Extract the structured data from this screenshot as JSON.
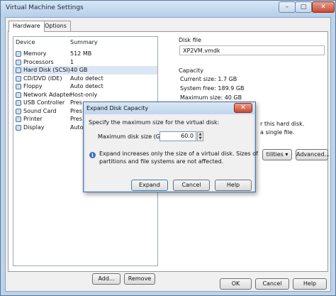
{
  "window": {
    "title": "Virtual Machine Settings",
    "minimize": "–",
    "maximize": "□",
    "close": "✕"
  },
  "tabs": [
    {
      "label": "Hardware"
    },
    {
      "label": "Options"
    }
  ],
  "device_list": {
    "columns": [
      "Device",
      "Summary"
    ],
    "rows": [
      {
        "name": "Memory",
        "summary": "512 MB",
        "icon": "memory-icon"
      },
      {
        "name": "Processors",
        "summary": "1",
        "icon": "processor-icon"
      },
      {
        "name": "Hard Disk (SCSI)",
        "summary": "40 GB",
        "icon": "hard-disk-icon",
        "selected": true
      },
      {
        "name": "CD/DVD (IDE)",
        "summary": "Auto detect",
        "icon": "cd-dvd-icon"
      },
      {
        "name": "Floppy",
        "summary": "Auto detect",
        "icon": "floppy-icon"
      },
      {
        "name": "Network Adapter",
        "summary": "Host-only",
        "icon": "network-icon"
      },
      {
        "name": "USB Controller",
        "summary": "Pres",
        "icon": "usb-icon"
      },
      {
        "name": "Sound Card",
        "summary": "Pres",
        "icon": "sound-card-icon"
      },
      {
        "name": "Printer",
        "summary": "Pres",
        "icon": "printer-icon"
      },
      {
        "name": "Display",
        "summary": "Auto",
        "icon": "display-icon"
      }
    ]
  },
  "buttons": {
    "add": "Add...",
    "remove": "Remove",
    "ok": "OK",
    "cancel": "Cancel",
    "help": "Help"
  },
  "disk_file": {
    "label": "Disk file",
    "value": "XP2VM.vmdk"
  },
  "capacity": {
    "label": "Capacity",
    "current_size": "Current size:  1.7 GB",
    "system_free": "System free:   189.9 GB",
    "maximum_size": "Maximum size:  40 GB"
  },
  "utilities_partial": {
    "line1": "r this hard disk.",
    "line2": "a single file.",
    "utilities_button": "tilities ▾",
    "advanced_button": "Advanced..."
  },
  "dialog": {
    "title": "Expand Disk Capacity",
    "close": "✕",
    "prompt": "Specify the maximum size for the virtual disk:",
    "size_label": "Maximum disk size (GB):",
    "size_value": "60.0",
    "info_line1": "Expand increases only the size of a virtual disk. Sizes of",
    "info_line2": "partitions and file systems are not affected.",
    "expand": "Expand",
    "cancel": "Cancel",
    "help": "Help"
  }
}
